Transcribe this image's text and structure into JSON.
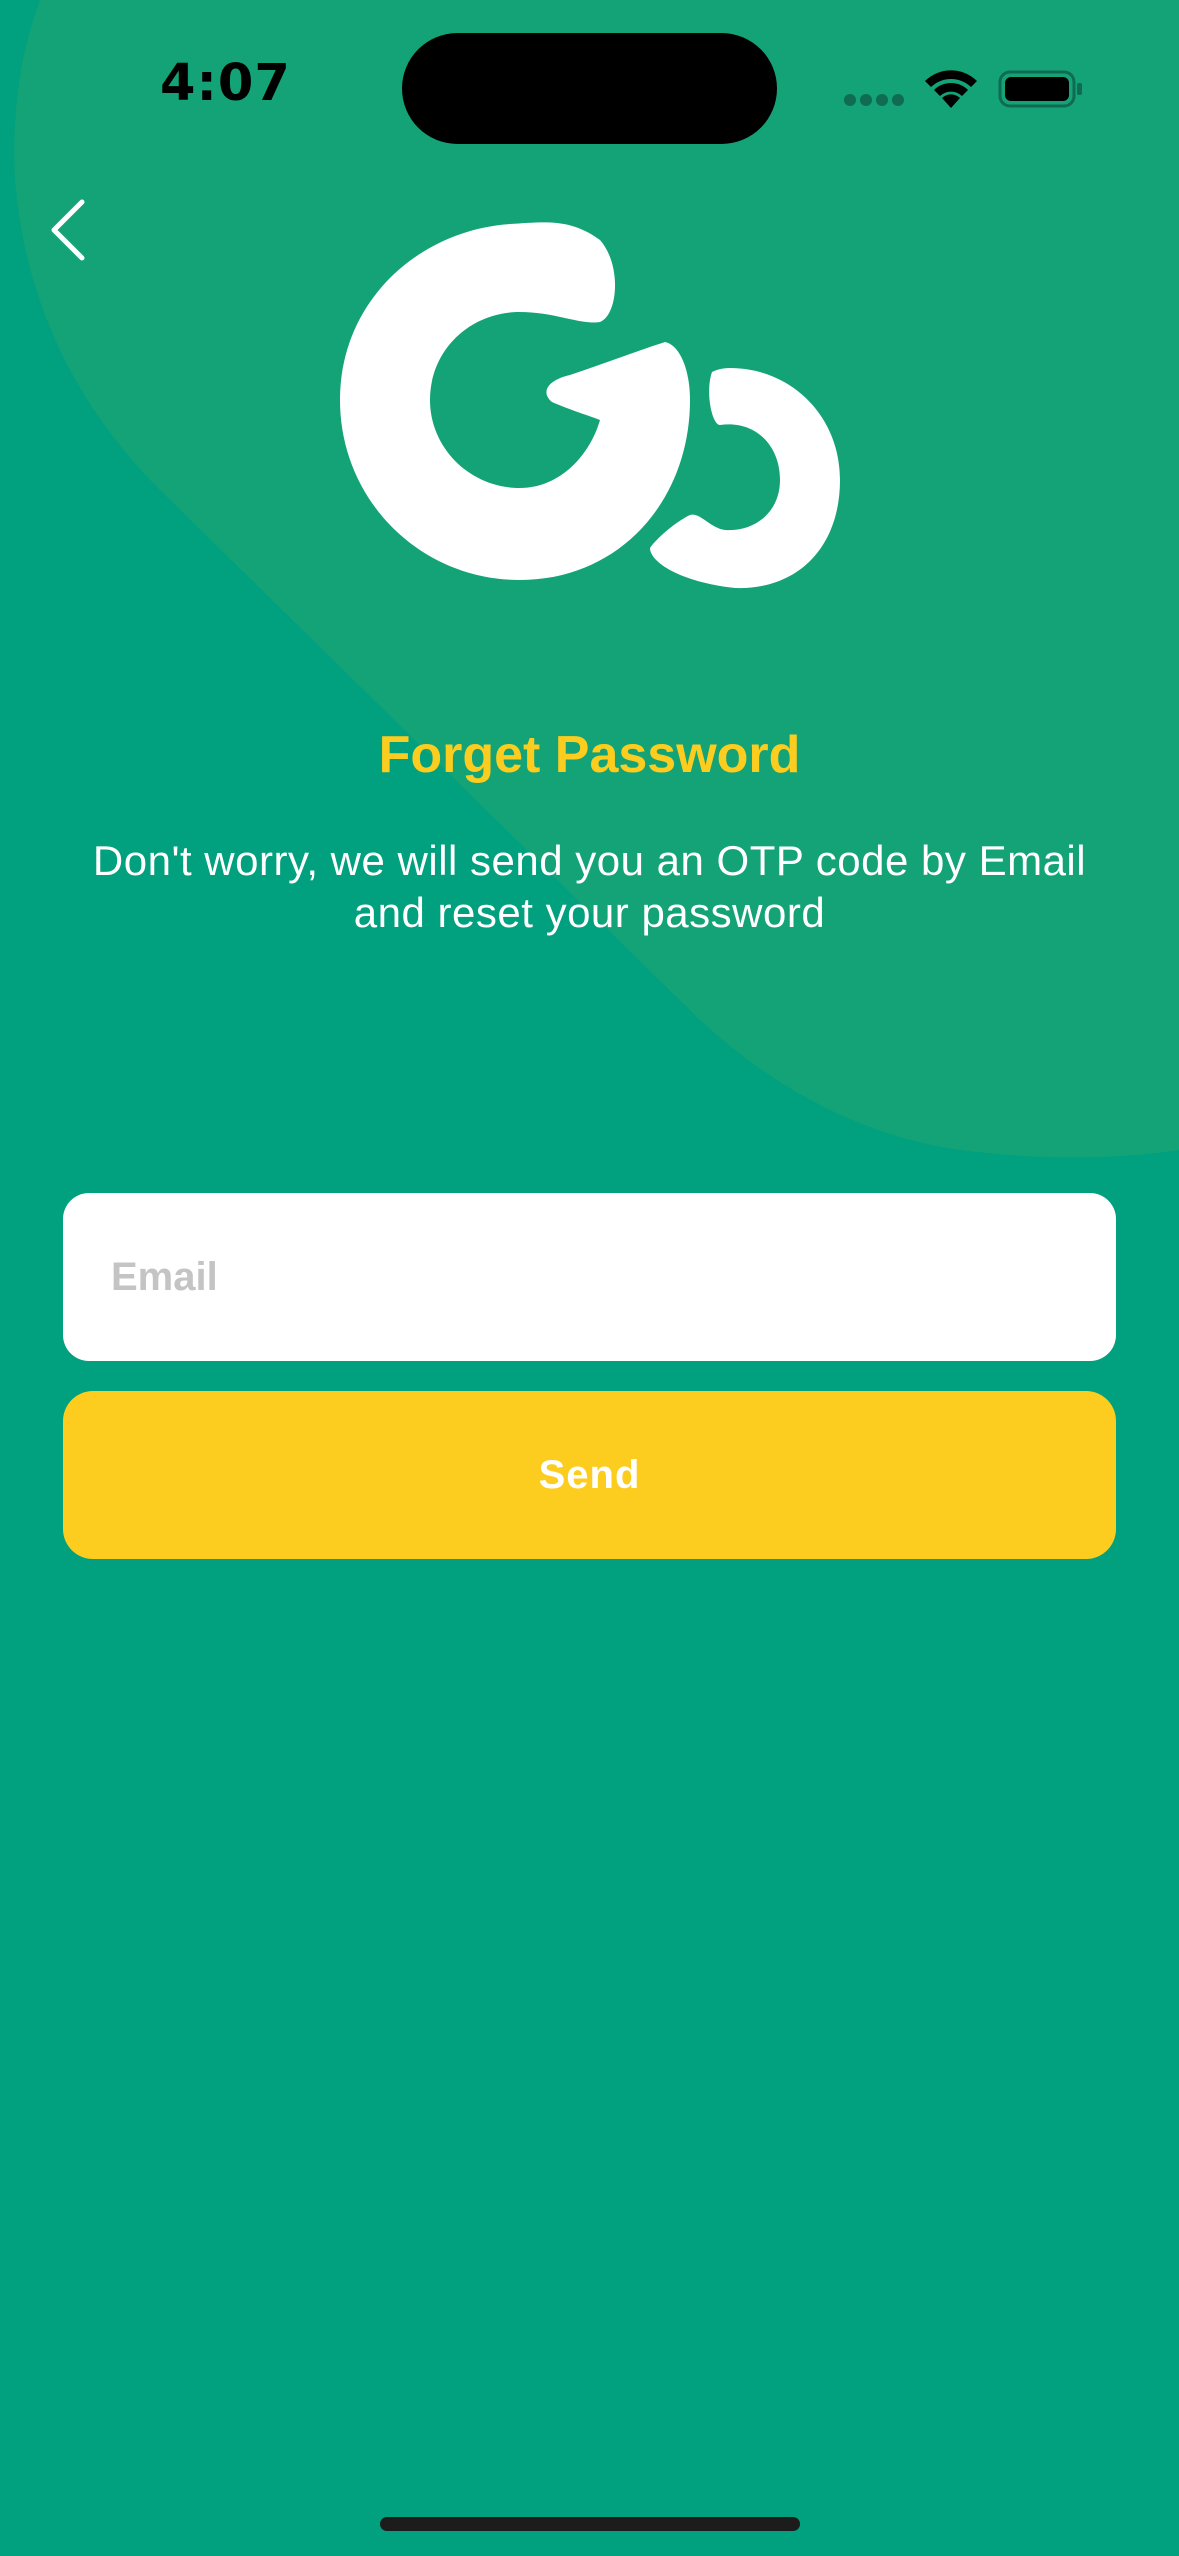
{
  "status_bar": {
    "time": "4:07"
  },
  "header": {
    "back_icon": "chevron-left-icon",
    "logo_icon": "go-logo-icon"
  },
  "main": {
    "title": "Forget Password",
    "subtitle_line1": "Don't worry, we will send you an OTP code by Email",
    "subtitle_line2": "and reset your password"
  },
  "form": {
    "email_placeholder": "Email",
    "email_value": "",
    "send_label": "Send"
  },
  "colors": {
    "background": "#01a07e",
    "background_blob": "#14a377",
    "accent": "#fccd1f",
    "field": "#ffffff",
    "placeholder": "#c4c4c4"
  }
}
